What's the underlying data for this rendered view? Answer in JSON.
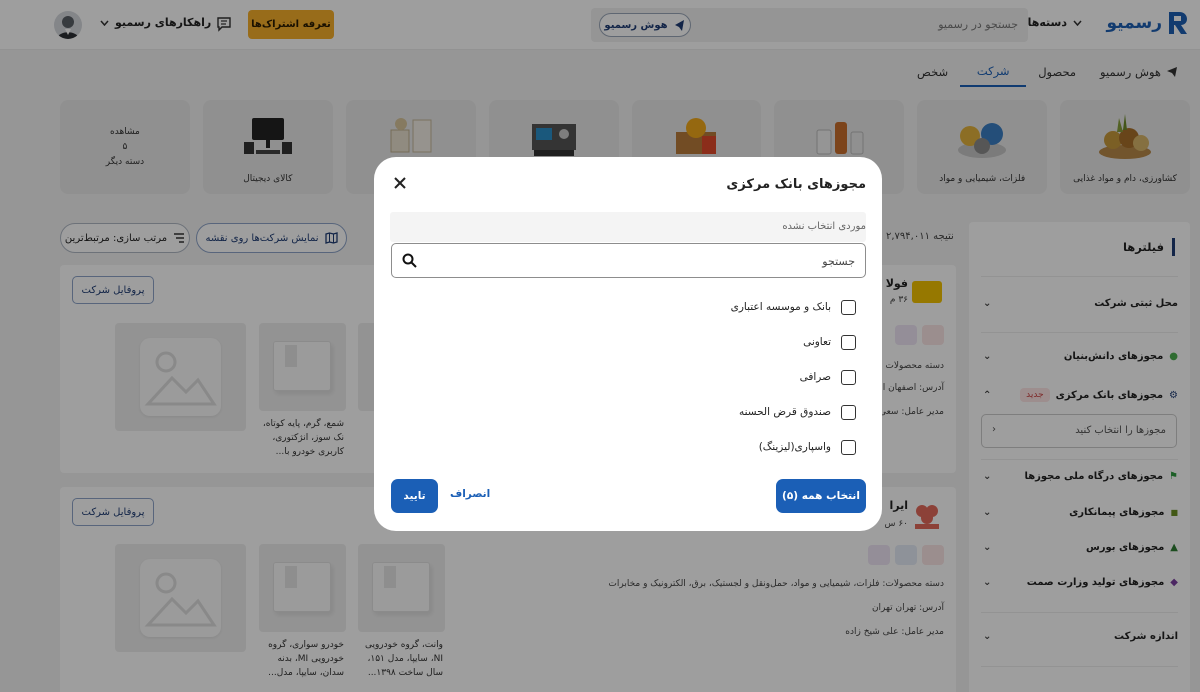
{
  "header": {
    "logo_text": "رسمیو",
    "categories_label": "دسته‌ها",
    "search_placeholder": "جستجو در رسمیو",
    "ai_button_label": "هوش رسمیو",
    "plans_button_label": "تعرفه اشتراک‌ها",
    "solutions_label": "راهکارهای رسمیو"
  },
  "tabs": [
    {
      "label": "هوش رسمیو"
    },
    {
      "label": "محصول"
    },
    {
      "label": "شرکت"
    },
    {
      "label": "شخص"
    }
  ],
  "active_tab": "شرکت",
  "category_strip": {
    "items": [
      {
        "label": "کشاورزی، دام و مواد غذایی"
      },
      {
        "label": "فلزات، شیمیایی و مواد"
      },
      {
        "label": ""
      },
      {
        "label": ""
      },
      {
        "label": ""
      },
      {
        "label": ""
      },
      {
        "label": "کالای دیجیتال"
      }
    ],
    "more": {
      "line1": "مشاهده",
      "line2": "۵",
      "line3": "دسته دیگر"
    }
  },
  "toolbar": {
    "sort_label": "مرتب سازی: مرتبط‌ترین",
    "map_label": "نمایش شرکت‌ها روی نقشه",
    "result_count": "۲,۷۹۴,۰۱۱ نتیجه"
  },
  "sidebar": {
    "title": "فیلترها",
    "filters": [
      {
        "label": "محل ثبتی شرکت"
      },
      {
        "label": "مجوزهای دانش‌بنیان"
      },
      {
        "label": "مجوزهای بانک مرکزی",
        "badge": "جدید"
      },
      {
        "label": "مجوزهای درگاه ملی مجوزها"
      },
      {
        "label": "مجوزهای پیمانکاری"
      },
      {
        "label": "مجوزهای بورس"
      },
      {
        "label": "مجوزهای تولید وزارت صمت"
      },
      {
        "label": "اندازه شرکت"
      }
    ],
    "license_select_placeholder": "مجوزها را انتخاب کنید"
  },
  "cards": [
    {
      "name": "فولا",
      "sub": "۳۶ م",
      "profile_label": "پروفایل شرکت",
      "meta_category": "دسته محصولات",
      "meta_address": "آدرس: اصفهان ا",
      "meta_manager": "مدیر عامل: سعی",
      "products": [
        {
          "text": "شمع، گرم، پایه کوتاه، نک سوز، انژکتوری، کاربری خودرو با..."
        }
      ]
    },
    {
      "name": "ایرا",
      "sub": "۶۰ س",
      "profile_label": "پروفایل شرکت",
      "meta_category": "دسته محصولات: فلزات، شیمیایی و مواد، حمل‌ونقل و لجستیک، برق، الکترونیک و مخابرات",
      "meta_address": "آدرس: تهران تهران",
      "meta_manager": "مدیر عامل: علی شیخ زاده",
      "products": [
        {
          "text": "وانت، گروه خودرویی NI، سایپا، مدل ۱۵۱، سال ساخت ۱۳۹۸..."
        },
        {
          "text": "خودرو سواری، گروه خودرویی MI، بدنه سدان، سایپا، مدل..."
        }
      ]
    }
  ],
  "modal": {
    "title": "مجوزهای بانک مرکزی",
    "selected_text": "موردی انتخاب نشده",
    "search_placeholder": "جستجو",
    "options": [
      {
        "label": "بانک و موسسه اعتباری"
      },
      {
        "label": "تعاونی"
      },
      {
        "label": "صرافی"
      },
      {
        "label": "صندوق قرض الحسنه"
      },
      {
        "label": "واسپاری(لیزینگ)"
      }
    ],
    "select_all_label": "انتخاب همه (۵)",
    "cancel_label": "انصراف",
    "confirm_label": "تایید"
  },
  "colors": {
    "brand_blue": "#1b5fb6",
    "plans_yellow": "#f5ae2a",
    "overlay": "rgba(0,0,0,0.38)"
  },
  "icons": [
    "logo-icon",
    "chevron-down-icon",
    "ai-logo-icon",
    "chat-icon",
    "avatar",
    "search-icon",
    "close-icon",
    "map-icon",
    "sort-icon",
    "checkbox-icon"
  ]
}
